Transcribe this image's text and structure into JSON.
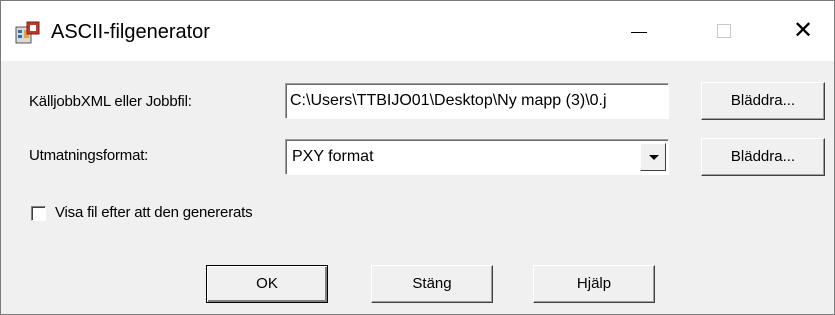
{
  "window": {
    "title": "ASCII-filgenerator",
    "app_icon": "generator-app-icon",
    "minimize_icon": "minimize-icon",
    "maximize_icon": "maximize-icon",
    "close_icon": "close-icon"
  },
  "form": {
    "source_label": "KälljobbXML eller Jobbfil:",
    "source_value": "C:\\Users\\TTBIJO01\\Desktop\\Ny mapp (3)\\0.j",
    "browse1_label": "Bläddra...",
    "format_label": "Utmatningsformat:",
    "format_value": "PXY format",
    "browse2_label": "Bläddra...",
    "show_file_label": "Visa fil efter att den genererats",
    "show_file_checked": false
  },
  "buttons": {
    "ok": "OK",
    "close": "Stäng",
    "help": "Hjälp"
  }
}
